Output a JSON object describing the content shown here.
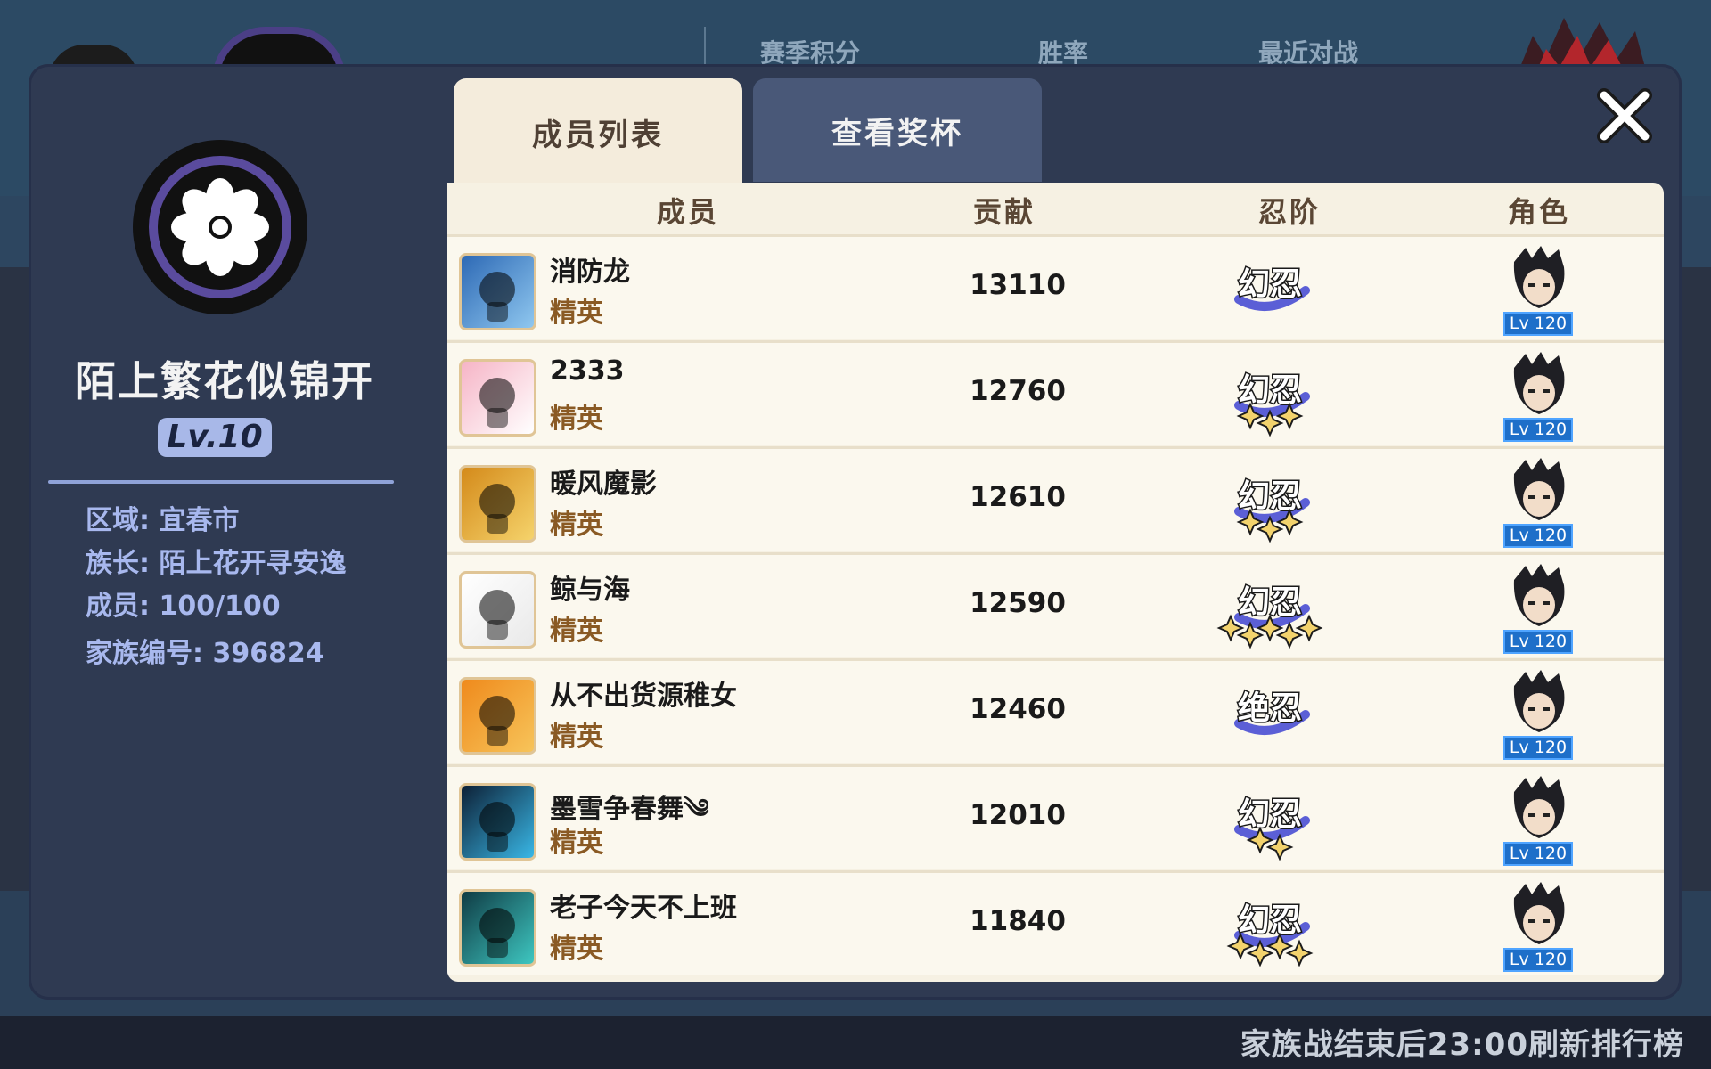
{
  "background": {
    "headers": [
      "赛季积分",
      "胜率",
      "最近对战"
    ],
    "footer_note": "家族战结束后23:00刷新排行榜"
  },
  "clan": {
    "name": "陌上繁花似锦开",
    "level": "Lv.10",
    "region": "区域: 宜春市",
    "leader": "族长: 陌上花开寻安逸",
    "members": "成员: 100/100",
    "clan_id": "家族编号: 396824"
  },
  "tabs": {
    "members": "成员列表",
    "trophies": "查看奖杯"
  },
  "table": {
    "headers": {
      "member": "成员",
      "contribution": "贡献",
      "rank": "忍阶",
      "role": "角色"
    },
    "rows": [
      {
        "name": "消防龙",
        "title": "精英",
        "contribution": "13110",
        "rank_text": "幻忍",
        "stars": 0,
        "role_level": "Lv 120",
        "avatar": "ice-monster",
        "colors": [
          "#2d69b5",
          "#8fc7ef"
        ]
      },
      {
        "name": "2333",
        "title": "精英",
        "contribution": "12760",
        "rank_text": "幻忍",
        "stars": 3,
        "role_level": "Lv 120",
        "avatar": "bottle",
        "colors": [
          "#f6b4c6",
          "#ffffff"
        ]
      },
      {
        "name": "暖风魔影",
        "title": "精英",
        "contribution": "12610",
        "rank_text": "幻忍",
        "stars": 3,
        "role_level": "Lv 120",
        "avatar": "stickman",
        "colors": [
          "#d48a1a",
          "#f5d36b"
        ]
      },
      {
        "name": "鲸与海",
        "title": "精英",
        "contribution": "12590",
        "rank_text": "幻忍",
        "stars": 5,
        "role_level": "Lv 120",
        "avatar": "silhouette",
        "colors": [
          "#ffffff",
          "#e9e9e9"
        ]
      },
      {
        "name": "从不出货源稚女",
        "title": "精英",
        "contribution": "12460",
        "rank_text": "绝忍",
        "stars": 0,
        "role_level": "Lv 120",
        "avatar": "hammer-diamond",
        "colors": [
          "#ef8a1c",
          "#f7c45a"
        ]
      },
      {
        "name": "墨雪争春舞༄",
        "title": "精英",
        "contribution": "12010",
        "rank_text": "幻忍",
        "stars": 2,
        "role_level": "Lv 120",
        "avatar": "shadow-ninja",
        "colors": [
          "#0d2036",
          "#39b7e6"
        ]
      },
      {
        "name": "老子今天不上班",
        "title": "精英",
        "contribution": "11840",
        "rank_text": "幻忍",
        "stars": 4,
        "role_level": "Lv 120",
        "avatar": "shadow-dragon",
        "colors": [
          "#0f3b44",
          "#3ec7c1"
        ]
      }
    ]
  }
}
